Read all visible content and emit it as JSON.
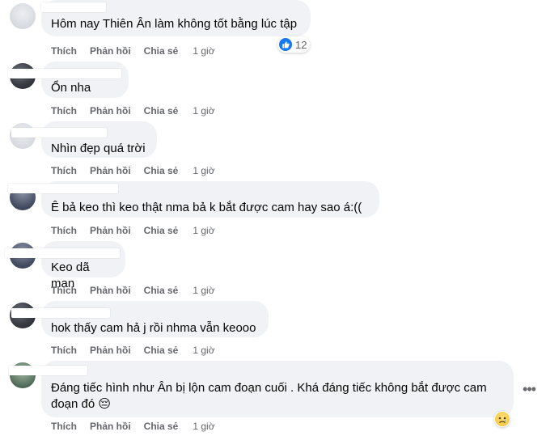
{
  "actions": {
    "like": "Thích",
    "reply": "Phản hồi",
    "share": "Chia sẻ"
  },
  "comments": [
    {
      "text": "Hôm nay Thiên Ân làm không tốt bằng lúc tập",
      "time": "1 giờ",
      "reaction_count": "12"
    },
    {
      "text": "Ổn nha",
      "time": "1 giờ"
    },
    {
      "text": "Nhìn đẹp quá trời",
      "time": "1 giờ"
    },
    {
      "text": "Ê bả keo thì keo thật nma bả k bắt được cam hay sao á:((",
      "time": "1 giờ"
    },
    {
      "text": "Keo dã man",
      "time": "1 giờ"
    },
    {
      "text": "hok thấy cam hả j rồi nhma vẫn keooo",
      "time": "1 giờ"
    },
    {
      "text": "Đáng tiếc hình như Ân bị lộn cam đoạn cuối . Khá đáng tiếc không bắt được cam\nđoạn đó 😔",
      "time": "1 giờ"
    }
  ],
  "icons": {
    "like": "like-thumb-icon",
    "sad": "sad-reaction-icon",
    "more": "more-options-icon"
  },
  "colors": {
    "bubble": "#f0f2f5",
    "meta": "#65676b",
    "like": "#1877f2"
  }
}
